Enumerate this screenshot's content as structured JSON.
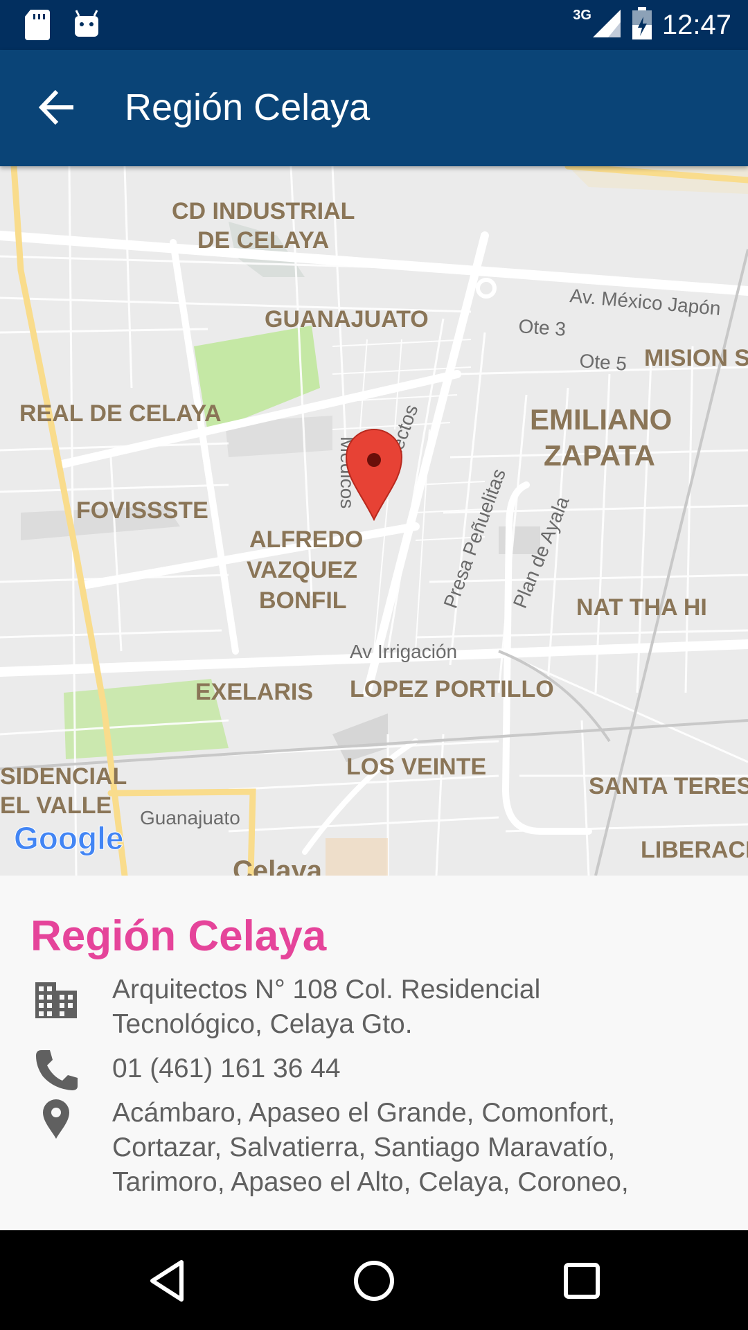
{
  "status_bar": {
    "time": "12:47",
    "network": "3G",
    "icons": [
      "sd-card-icon",
      "android-icon",
      "signal-icon",
      "battery-icon"
    ]
  },
  "app_bar": {
    "title": "Región Celaya",
    "back_icon": "arrow-back-icon"
  },
  "map": {
    "labels": {
      "cd_industrial_1": "CD INDUSTRIAL",
      "cd_industrial_2": "DE CELAYA",
      "guanajuato": "GUANAJUATO",
      "av_mexico_japon": "Av. México Japón",
      "ote3": "Ote 3",
      "ote5": "Ote 5",
      "mision": "MISION S",
      "real_de_celaya": "REAL DE CELAYA",
      "emiliano": "EMILIANO",
      "zapata": "ZAPATA",
      "medicos": "Medicos",
      "arquitectos": "Arquitectos",
      "presa": "Presa Peñuelitas",
      "plan_de_ayala": "Plan de Ayala",
      "fovissste": "FOVISSSTE",
      "alfredo": "ALFREDO",
      "vazquez": "VAZQUEZ",
      "bonfil": "BONFIL",
      "nat_tha_hi": "NAT THA HI",
      "av_irrigacion": "Av Irrigación",
      "exelaris": "EXELARIS",
      "lopez_portillo": "LOPEZ PORTILLO",
      "residencial": "SIDENCIAL",
      "el_valle": "EL VALLE",
      "los_veinte": "LOS VEINTE",
      "santa_teresa": "SANTA TERESI",
      "guanajuato_road": "Guanajuato",
      "liberacion": "LIBERACIO",
      "celaya": "Celaya",
      "google": "Google"
    },
    "marker_icon": "map-pin-icon",
    "colors": {
      "park": "#c5e8a5",
      "road": "#ffffff",
      "highway": "#f9dc8c",
      "label": "#8a7557"
    }
  },
  "info": {
    "title": "Región Celaya",
    "address_line1": "Arquitectos N° 108 Col. Residencial",
    "address_line2": "Tecnológico, Celaya Gto.",
    "phone": "01 (461) 161 36 44",
    "coverage_line1": "Acámbaro, Apaseo el Grande, Comonfort,",
    "coverage_line2": "Cortazar, Salvatierra, Santiago Maravatío,",
    "coverage_line3": "Tarimoro, Apaseo el Alto, Celaya, Coroneo,",
    "icons": [
      "building-icon",
      "phone-icon",
      "location-pin-icon"
    ],
    "title_color": "#e5449a"
  },
  "nav_bar": {
    "icons": [
      "nav-back-icon",
      "nav-home-icon",
      "nav-recents-icon"
    ]
  }
}
